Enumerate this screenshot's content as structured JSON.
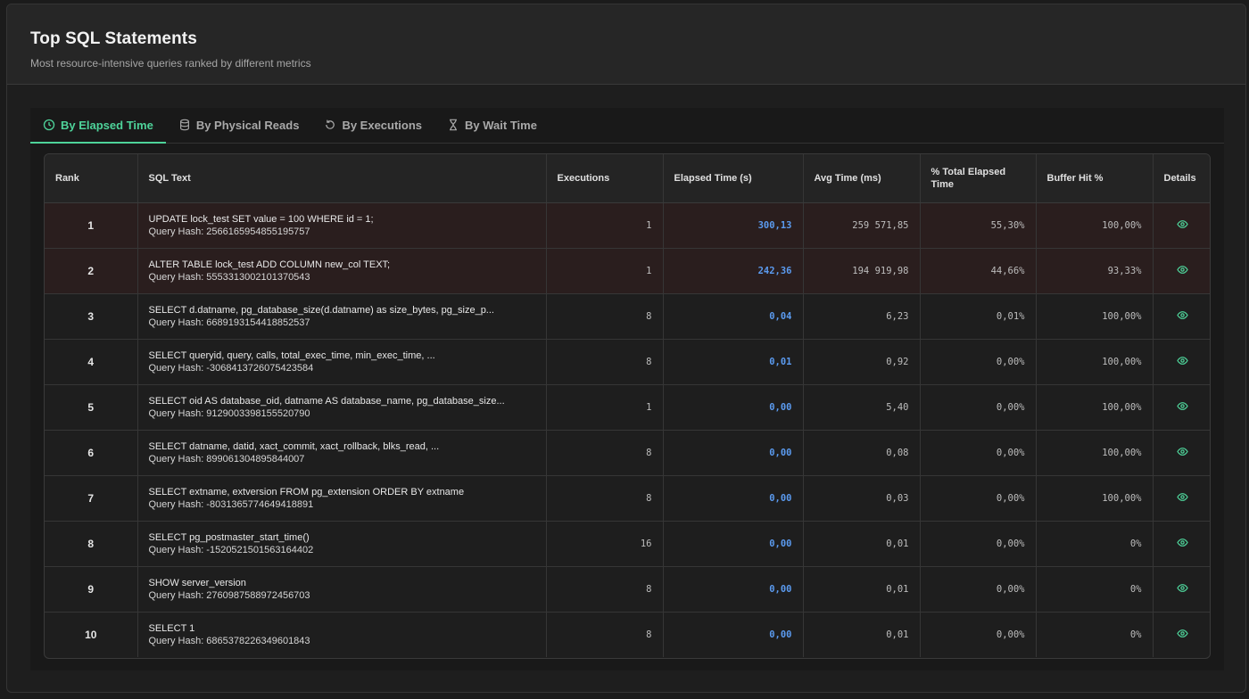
{
  "header": {
    "title": "Top SQL Statements",
    "subtitle": "Most resource-intensive queries ranked by different metrics"
  },
  "tabs": [
    {
      "label": "By Elapsed Time",
      "icon": "clock-icon",
      "active": true
    },
    {
      "label": "By Physical Reads",
      "icon": "database-icon",
      "active": false
    },
    {
      "label": "By Executions",
      "icon": "refresh-icon",
      "active": false
    },
    {
      "label": "By Wait Time",
      "icon": "hourglass-icon",
      "active": false
    }
  ],
  "table": {
    "columns": [
      "Rank",
      "SQL Text",
      "Executions",
      "Elapsed Time (s)",
      "Avg Time (ms)",
      "% Total Elapsed Time",
      "Buffer Hit %",
      "Details"
    ],
    "rows": [
      {
        "rank": "1",
        "sql": "UPDATE lock_test SET value = 100 WHERE id = 1;",
        "hash": "Query Hash: 2566165954855195757",
        "executions": "1",
        "elapsed": "300,13",
        "avg": "259 571,85",
        "pct": "55,30%",
        "buffer": "100,00%",
        "hot": true
      },
      {
        "rank": "2",
        "sql": "ALTER TABLE lock_test ADD COLUMN new_col TEXT;",
        "hash": "Query Hash: 5553313002101370543",
        "executions": "1",
        "elapsed": "242,36",
        "avg": "194 919,98",
        "pct": "44,66%",
        "buffer": "93,33%",
        "hot": true
      },
      {
        "rank": "3",
        "sql": "SELECT d.datname, pg_database_size(d.datname) as size_bytes, pg_size_p...",
        "hash": "Query Hash: 6689193154418852537",
        "executions": "8",
        "elapsed": "0,04",
        "avg": "6,23",
        "pct": "0,01%",
        "buffer": "100,00%",
        "hot": false
      },
      {
        "rank": "4",
        "sql": "SELECT queryid, query, calls, total_exec_time, min_exec_time, ...",
        "hash": "Query Hash: -3068413726075423584",
        "executions": "8",
        "elapsed": "0,01",
        "avg": "0,92",
        "pct": "0,00%",
        "buffer": "100,00%",
        "hot": false
      },
      {
        "rank": "5",
        "sql": "SELECT oid AS database_oid, datname AS database_name, pg_database_size...",
        "hash": "Query Hash: 9129003398155520790",
        "executions": "1",
        "elapsed": "0,00",
        "avg": "5,40",
        "pct": "0,00%",
        "buffer": "100,00%",
        "hot": false
      },
      {
        "rank": "6",
        "sql": "SELECT datname, datid, xact_commit, xact_rollback, blks_read, ...",
        "hash": "Query Hash: 899061304895844007",
        "executions": "8",
        "elapsed": "0,00",
        "avg": "0,08",
        "pct": "0,00%",
        "buffer": "100,00%",
        "hot": false
      },
      {
        "rank": "7",
        "sql": "SELECT extname, extversion FROM pg_extension ORDER BY extname",
        "hash": "Query Hash: -8031365774649418891",
        "executions": "8",
        "elapsed": "0,00",
        "avg": "0,03",
        "pct": "0,00%",
        "buffer": "100,00%",
        "hot": false
      },
      {
        "rank": "8",
        "sql": "SELECT pg_postmaster_start_time()",
        "hash": "Query Hash: -1520521501563164402",
        "executions": "16",
        "elapsed": "0,00",
        "avg": "0,01",
        "pct": "0,00%",
        "buffer": "0%",
        "hot": false
      },
      {
        "rank": "9",
        "sql": "SHOW server_version",
        "hash": "Query Hash: 2760987588972456703",
        "executions": "8",
        "elapsed": "0,00",
        "avg": "0,01",
        "pct": "0,00%",
        "buffer": "0%",
        "hot": false
      },
      {
        "rank": "10",
        "sql": "SELECT 1",
        "hash": "Query Hash: 6865378226349601843",
        "executions": "8",
        "elapsed": "0,00",
        "avg": "0,01",
        "pct": "0,00%",
        "buffer": "0%",
        "hot": false
      }
    ]
  },
  "colors": {
    "accent": "#4ed39a",
    "elapsed_value": "#5b9bf0",
    "hot_row": "#2a1e1e"
  }
}
